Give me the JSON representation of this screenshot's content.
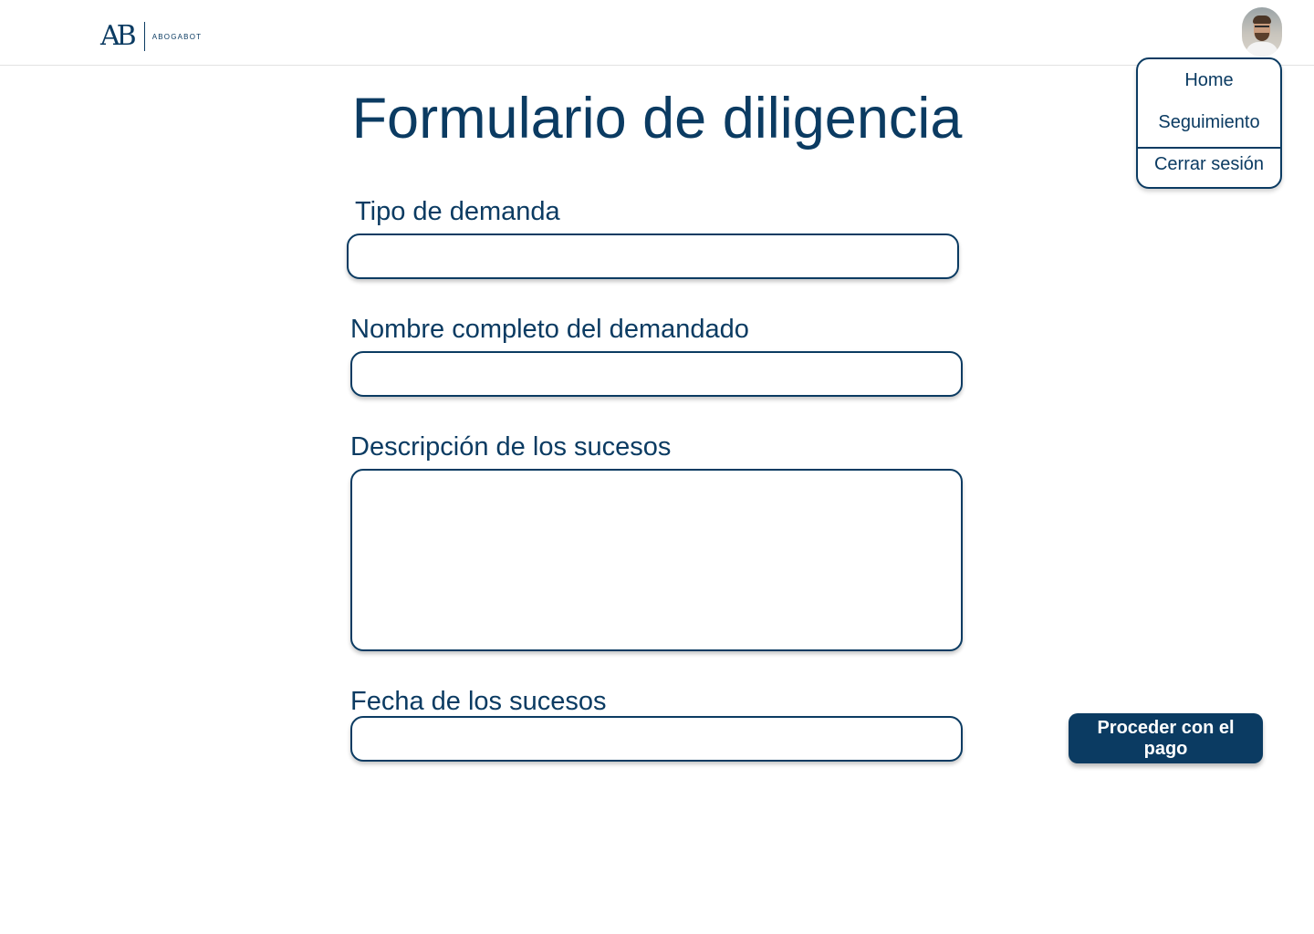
{
  "header": {
    "logo_mark": "AB",
    "logo_text": "ABOGABOT",
    "avatar_icon": "user-avatar-icon"
  },
  "menu": {
    "items": [
      {
        "label": "Home"
      },
      {
        "label": "Seguimiento"
      },
      {
        "label": "Cerrar sesión"
      }
    ]
  },
  "form": {
    "title": "Formulario de diligencia",
    "fields": [
      {
        "label": "Tipo de demanda",
        "value": "",
        "placeholder": ""
      },
      {
        "label": "Nombre completo del demandado",
        "value": "",
        "placeholder": ""
      },
      {
        "label": "Descripción de los sucesos",
        "value": "",
        "placeholder": ""
      },
      {
        "label": "Fecha de los sucesos",
        "value": "",
        "placeholder": ""
      }
    ],
    "submit_label": "Proceder con el pago"
  },
  "colors": {
    "primary": "#0b3b62",
    "background": "#ffffff"
  }
}
